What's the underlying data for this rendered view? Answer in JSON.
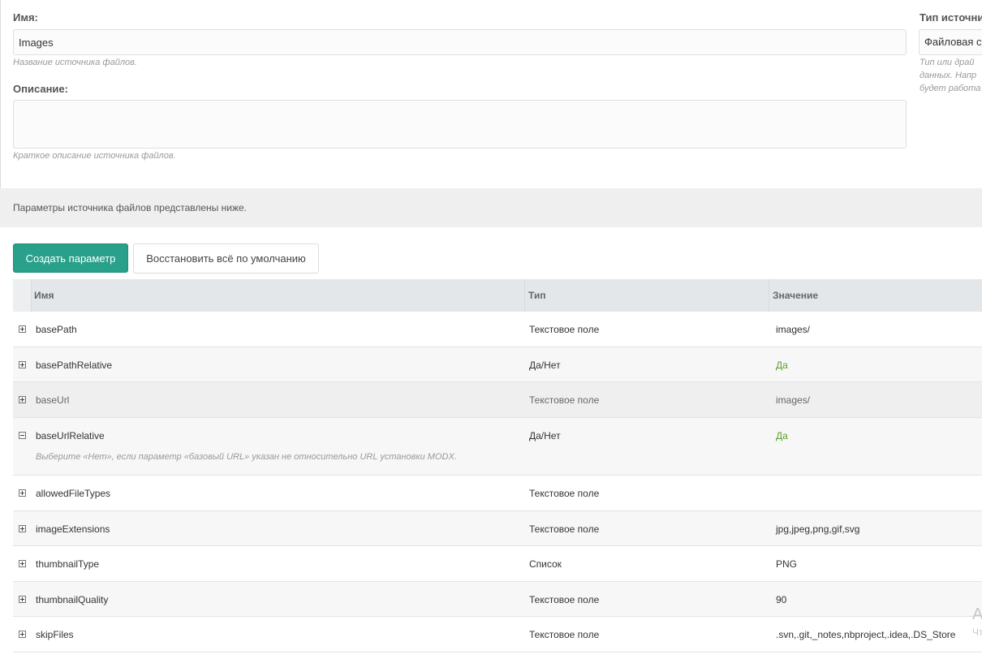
{
  "form": {
    "name_label": "Имя:",
    "name_value": "Images",
    "name_help": "Название источника файлов.",
    "description_label": "Описание:",
    "description_value": "",
    "description_help": "Краткое описание источника файлов.",
    "type_label": "Тип источни",
    "type_value": "Файловая си",
    "type_help_line1": "Тип или драй",
    "type_help_line2": "данных. Напр",
    "type_help_line3": "будет работа"
  },
  "banner": {
    "text": "Параметры источника файлов представлены ниже."
  },
  "toolbar": {
    "create_label": "Создать параметр",
    "reset_label": "Восстановить всё по умолчанию"
  },
  "grid": {
    "columns": [
      "Имя",
      "Тип",
      "Значение"
    ],
    "rows": [
      {
        "name": "basePath",
        "type": "Текстовое поле",
        "value": "images/"
      },
      {
        "name": "basePathRelative",
        "type": "Да/Нет",
        "value": "Да"
      },
      {
        "name": "baseUrl",
        "type": "Текстовое поле",
        "value": "images/"
      },
      {
        "name": "baseUrlRelative",
        "type": "Да/Нет",
        "value": "Да",
        "description": "Выберите «Нет», если параметр «базовый URL» указан не относительно URL установки MODX."
      },
      {
        "name": "allowedFileTypes",
        "type": "Текстовое поле",
        "value": ""
      },
      {
        "name": "imageExtensions",
        "type": "Текстовое поле",
        "value": "jpg,jpeg,png,gif,svg"
      },
      {
        "name": "thumbnailType",
        "type": "Список",
        "value": "PNG"
      },
      {
        "name": "thumbnailQuality",
        "type": "Текстовое поле",
        "value": "90"
      },
      {
        "name": "skipFiles",
        "type": "Текстовое поле",
        "value": ".svn,.git,_notes,nbproject,.idea,.DS_Store"
      }
    ]
  },
  "edge": {
    "glyph1": "A",
    "glyph2": "Чт"
  },
  "colors": {
    "primary": "#28a08a",
    "true_value": "#5aa02c"
  }
}
